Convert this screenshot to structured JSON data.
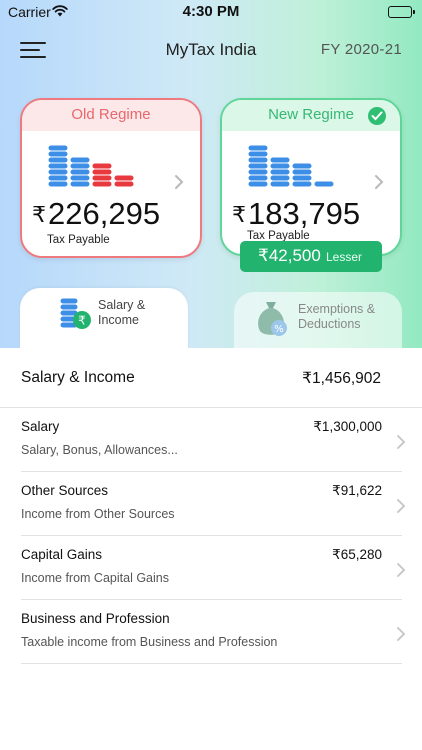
{
  "status_bar": {
    "carrier": "Carrier",
    "time": "4:30 PM"
  },
  "header": {
    "title": "MyTax India",
    "fiscal_year": "FY 2020-21"
  },
  "regimes": {
    "old": {
      "title": "Old Regime",
      "currency": "₹",
      "amount": "226,295",
      "label": "Tax Payable",
      "accent": "#ee7a7f"
    },
    "new": {
      "title": "New Regime",
      "currency": "₹",
      "amount": "183,795",
      "label": "Tax Payable",
      "accent": "#37b874",
      "selected": true
    }
  },
  "savings_badge": {
    "amount": "₹42,500",
    "text": "Lesser",
    "color": "#22b46e"
  },
  "tabs": [
    {
      "line1": "Salary &",
      "line2": "Income",
      "active": true,
      "icon": "coins-rupee-icon"
    },
    {
      "line1": "Exemptions &",
      "line2": "Deductions",
      "active": false,
      "icon": "money-bag-percent-icon"
    }
  ],
  "summary": {
    "title": "Salary & Income",
    "value": "₹1,456,902"
  },
  "items": [
    {
      "title": "Salary",
      "subtitle": "Salary, Bonus, Allowances...",
      "value": "₹1,300,000"
    },
    {
      "title": "Other Sources",
      "subtitle": "Income from Other Sources",
      "value": "₹91,622"
    },
    {
      "title": "Capital Gains",
      "subtitle": "Income from Capital Gains",
      "value": "₹65,280"
    },
    {
      "title": "Business and Profession",
      "subtitle": "Taxable income from Business and Profession",
      "value": ""
    }
  ]
}
